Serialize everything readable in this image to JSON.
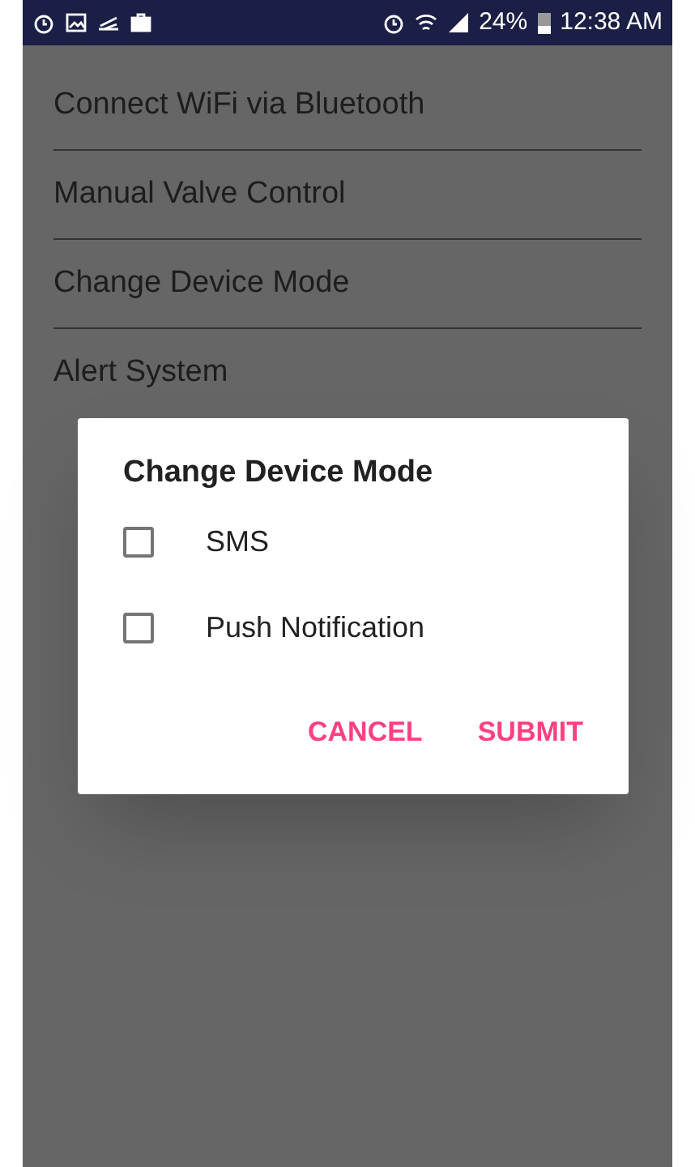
{
  "status_bar": {
    "battery": "24%",
    "time": "12:38 AM"
  },
  "menu": {
    "items": [
      {
        "label": "Connect WiFi via Bluetooth"
      },
      {
        "label": "Manual Valve Control"
      },
      {
        "label": "Change Device Mode"
      },
      {
        "label": "Alert System"
      }
    ]
  },
  "dialog": {
    "title": "Change Device Mode",
    "options": [
      {
        "label": "SMS",
        "checked": false
      },
      {
        "label": "Push Notification",
        "checked": false
      }
    ],
    "buttons": [
      "CANCEL",
      "SUBMIT"
    ]
  }
}
